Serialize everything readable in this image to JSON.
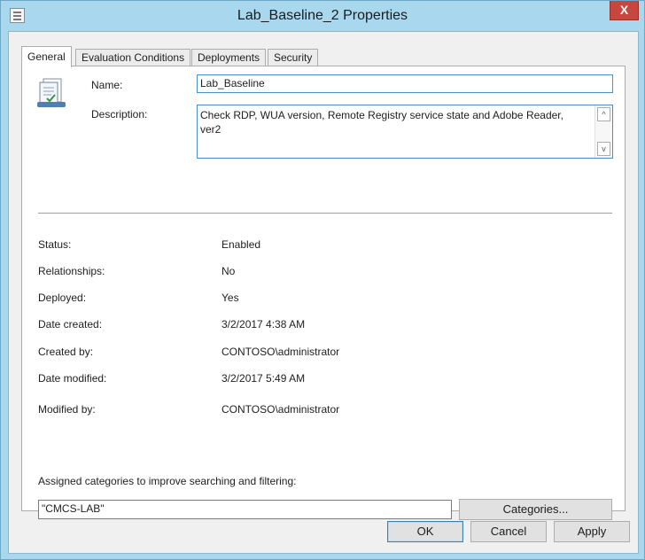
{
  "window": {
    "title": "Lab_Baseline_2 Properties",
    "close_glyph": "X",
    "system_icon": "properties-doc-icon"
  },
  "tabs": [
    {
      "label": "General",
      "active": true
    },
    {
      "label": "Evaluation Conditions",
      "active": false
    },
    {
      "label": "Deployments",
      "active": false
    },
    {
      "label": "Security",
      "active": false
    }
  ],
  "general": {
    "icon": "configuration-baseline-icon",
    "name_label": "Name:",
    "name_value": "Lab_Baseline",
    "description_label": "Description:",
    "description_line1": "Check RDP, WUA version, Remote Registry service state and Adobe Reader,",
    "description_line2": "ver2",
    "scroll_up_glyph": "^",
    "scroll_down_glyph": "v",
    "properties": [
      {
        "label": "Status:",
        "value": "Enabled"
      },
      {
        "label": "Relationships:",
        "value": "No"
      },
      {
        "label": "Deployed:",
        "value": "Yes"
      },
      {
        "label": "Date created:",
        "value": "3/2/2017 4:38 AM"
      },
      {
        "label": "Created by:",
        "value": "CONTOSO\\administrator"
      },
      {
        "label": "Date modified:",
        "value": "3/2/2017 5:49 AM"
      },
      {
        "label": "Modified by:",
        "value": "CONTOSO\\administrator"
      }
    ],
    "categories_label": "Assigned categories to improve searching and filtering:",
    "categories_value": "\"CMCS-LAB\"",
    "categories_button": "Categories..."
  },
  "buttons": {
    "ok": "OK",
    "cancel": "Cancel",
    "apply": "Apply"
  },
  "colors": {
    "frame": "#a9d7ee",
    "close": "#c7463f",
    "focus_border": "#4a90c8"
  }
}
